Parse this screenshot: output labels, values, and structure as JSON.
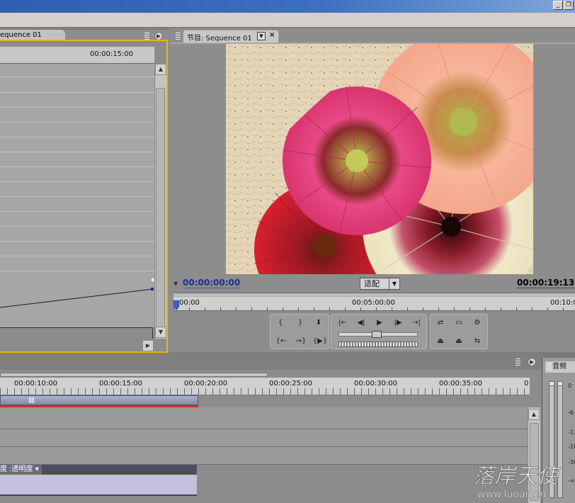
{
  "window": {
    "minimize_glyph": "_",
    "restore_glyph": "❐"
  },
  "effect_controls": {
    "tab_label": "equence 01",
    "ruler_timecode": "00:00:15:00"
  },
  "program_monitor": {
    "tab_label": "节目: Sequence 01",
    "current_timecode": "00:00:00:00",
    "duration_timecode": "00:00:19:13",
    "zoom_select": "适配",
    "ruler_times": [
      "00:00",
      "00:05:00:00",
      "00:10:0"
    ],
    "preview_description": "Pink, peach, red and cream gerbera daisies on textured paper",
    "transport_icons": {
      "set_in": "{",
      "set_out": "}",
      "set_marker": "⬇",
      "go_in": "{←",
      "go_out": "→}",
      "play_in_out": "{▶}",
      "go_to_in": "|←",
      "step_back": "◀|",
      "play": "▶",
      "step_forward": "|▶",
      "go_to_out": "→|",
      "loop": "⇄",
      "safe_margins": "▭",
      "output": "⚙",
      "lift": "⏏",
      "extract": "⏏",
      "trim": "⇆"
    }
  },
  "timeline": {
    "ruler_times": [
      "00:00:10:00",
      "00:00:15:00",
      "00:00:20:00",
      "00:00:25:00",
      "00:00:30:00",
      "00:00:35:00",
      "0"
    ],
    "clip_label": "度 :透明度 ▾"
  },
  "audio_master": {
    "tab_label": "音频",
    "labels": [
      "0",
      "-6",
      "-12",
      "-18",
      "-30",
      "-∞"
    ]
  },
  "watermark": {
    "text_cn": "落岸天使",
    "text_url": "www.luoan.cn"
  },
  "colors": {
    "active_panel_border": "#e8b51f",
    "timecode_blue": "#1b2c9a",
    "work_area_red": "#c8312b",
    "clip_fill": "#c3c0e0"
  }
}
